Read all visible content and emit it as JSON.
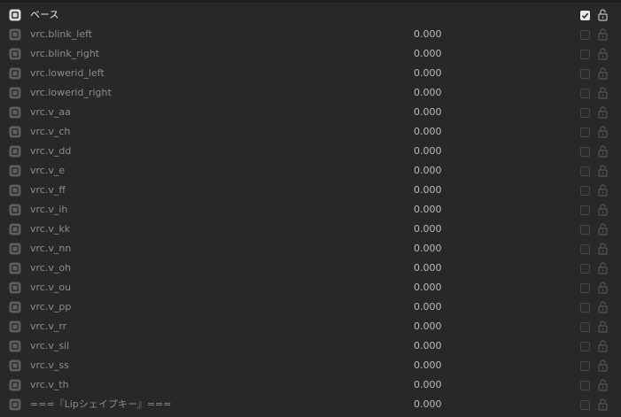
{
  "shape_keys": {
    "base": {
      "name": "ベース",
      "checked": true,
      "icon": "shape-key-icon",
      "lock_icon": "unlocked-padlock-icon"
    },
    "items": [
      {
        "name": "vrc.blink_left",
        "value": "0.000"
      },
      {
        "name": "vrc.blink_right",
        "value": "0.000"
      },
      {
        "name": "vrc.lowerid_left",
        "value": "0.000"
      },
      {
        "name": "vrc.lowerid_right",
        "value": "0.000"
      },
      {
        "name": "vrc.v_aa",
        "value": "0.000"
      },
      {
        "name": "vrc.v_ch",
        "value": "0.000"
      },
      {
        "name": "vrc.v_dd",
        "value": "0.000"
      },
      {
        "name": "vrc.v_e",
        "value": "0.000"
      },
      {
        "name": "vrc.v_ff",
        "value": "0.000"
      },
      {
        "name": "vrc.v_ih",
        "value": "0.000"
      },
      {
        "name": "vrc.v_kk",
        "value": "0.000"
      },
      {
        "name": "vrc.v_nn",
        "value": "0.000"
      },
      {
        "name": "vrc.v_oh",
        "value": "0.000"
      },
      {
        "name": "vrc.v_ou",
        "value": "0.000"
      },
      {
        "name": "vrc.v_pp",
        "value": "0.000"
      },
      {
        "name": "vrc.v_rr",
        "value": "0.000"
      },
      {
        "name": "vrc.v_sil",
        "value": "0.000"
      },
      {
        "name": "vrc.v_ss",
        "value": "0.000"
      },
      {
        "name": "vrc.v_th",
        "value": "0.000"
      },
      {
        "name": "===『Lipシェイプキー』===",
        "value": "0.000"
      }
    ]
  },
  "colors": {
    "background": "#282828",
    "text_dim": "#8c8c8c",
    "text_bright": "#e6e6e6",
    "value_text": "#bdbdbd",
    "checkbox_border": "#474747"
  }
}
